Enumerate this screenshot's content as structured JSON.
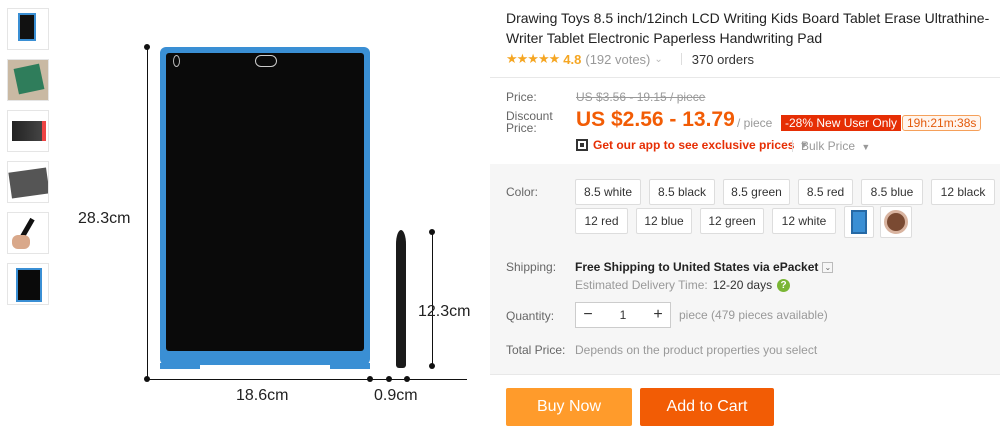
{
  "gallery": {
    "thumbnails": [
      "thumb-1",
      "thumb-2",
      "thumb-3",
      "thumb-4",
      "thumb-5",
      "thumb-6"
    ]
  },
  "product_image": {
    "height_label": "28.3cm",
    "width_label": "18.6cm",
    "pen_length_label": "12.3cm",
    "pen_width_label": "0.9cm"
  },
  "title": "Drawing Toys 8.5 inch/12inch LCD Writing Kids Board Tablet Erase Ultrathine-Writer Tablet Electronic Paperless Handwriting Pad",
  "rating": {
    "stars": "★★★★★",
    "score": "4.8",
    "votes": "(192 votes)",
    "orders": "370 orders"
  },
  "price": {
    "label": "Price:",
    "original": "US $3.56 - 19.15 / piece",
    "discount_label": "Discount Price:",
    "discount": "US $2.56 - 13.79",
    "unit": "/ piece",
    "badge": "-28% New User Only",
    "timer": "19h:21m:38s",
    "app_link": "Get our app to see exclusive prices",
    "bulk": "Bulk Price"
  },
  "color": {
    "label": "Color:",
    "options": [
      "8.5 white",
      "8.5 black",
      "8.5 green",
      "8.5 red",
      "8.5 blue",
      "12 black",
      "12 red",
      "12 blue",
      "12 green",
      "12 white"
    ]
  },
  "shipping": {
    "label": "Shipping:",
    "main": "Free Shipping to United States via ePacket",
    "estimated": "Estimated Delivery Time:",
    "days": "12-20 days"
  },
  "quantity": {
    "label": "Quantity:",
    "value": "1",
    "note": "piece (479 pieces available)"
  },
  "total": {
    "label": "Total Price:",
    "note": "Depends on the product properties you select"
  },
  "buttons": {
    "buy_now": "Buy Now",
    "add_to_cart": "Add to Cart"
  },
  "colors": {
    "accent": "#f25c05",
    "buy_now": "#ff9b2b",
    "star": "#f5a623",
    "tablet_frame": "#3a8fd4"
  }
}
